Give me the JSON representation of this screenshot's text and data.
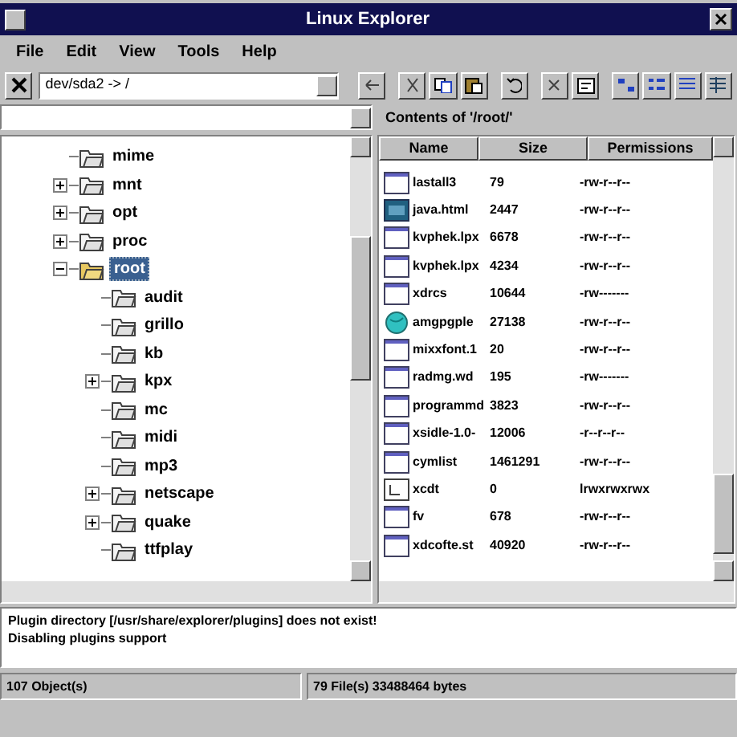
{
  "window": {
    "title": "Linux Explorer"
  },
  "menu": [
    "File",
    "Edit",
    "View",
    "Tools",
    "Help"
  ],
  "address": {
    "value": "dev/sda2 -> /"
  },
  "contents_label": "Contents of '/root/'",
  "tree": [
    {
      "label": "mime",
      "has_children": false,
      "expanded": false,
      "selected": false
    },
    {
      "label": "mnt",
      "has_children": true,
      "expanded": false,
      "selected": false
    },
    {
      "label": "opt",
      "has_children": true,
      "expanded": false,
      "selected": false
    },
    {
      "label": "proc",
      "has_children": true,
      "expanded": false,
      "selected": false
    },
    {
      "label": "root",
      "has_children": true,
      "expanded": true,
      "selected": true,
      "children": [
        {
          "label": "audit",
          "has_children": false,
          "expanded": false,
          "selected": false
        },
        {
          "label": "grillo",
          "has_children": false,
          "expanded": false,
          "selected": false
        },
        {
          "label": "kb",
          "has_children": false,
          "expanded": false,
          "selected": false
        },
        {
          "label": "kpx",
          "has_children": true,
          "expanded": false,
          "selected": false
        },
        {
          "label": "mc",
          "has_children": false,
          "expanded": false,
          "selected": false
        },
        {
          "label": "midi",
          "has_children": false,
          "expanded": false,
          "selected": false
        },
        {
          "label": "mp3",
          "has_children": false,
          "expanded": false,
          "selected": false
        },
        {
          "label": "netscape",
          "has_children": true,
          "expanded": false,
          "selected": false
        },
        {
          "label": "quake",
          "has_children": true,
          "expanded": false,
          "selected": false
        },
        {
          "label": "ttfplay",
          "has_children": false,
          "expanded": false,
          "selected": false
        }
      ]
    }
  ],
  "file_columns": [
    "Name",
    "Size",
    "Permissions"
  ],
  "files": [
    {
      "kind": "file",
      "name": "lastall3",
      "size": "79",
      "permissions": "-rw-r--r--"
    },
    {
      "kind": "html",
      "name": "java.html",
      "size": "2447",
      "permissions": "-rw-r--r--"
    },
    {
      "kind": "file",
      "name": "kvphek.lpx",
      "size": "6678",
      "permissions": "-rw-r--r--"
    },
    {
      "kind": "file",
      "name": "kvphek.lpx",
      "size": "4234",
      "permissions": "-rw-r--r--"
    },
    {
      "kind": "file",
      "name": "xdrcs",
      "size": "10644",
      "permissions": "-rw-------"
    },
    {
      "kind": "globe",
      "name": "amgpgple",
      "size": "27138",
      "permissions": "-rw-r--r--"
    },
    {
      "kind": "file",
      "name": "mixxfont.1",
      "size": "20",
      "permissions": "-rw-r--r--"
    },
    {
      "kind": "file",
      "name": "radmg.wd",
      "size": "195",
      "permissions": "-rw-------"
    },
    {
      "kind": "file",
      "name": "programmd",
      "size": "3823",
      "permissions": "-rw-r--r--"
    },
    {
      "kind": "file",
      "name": "xsidle-1.0-",
      "size": "12006",
      "permissions": "-r--r--r--"
    },
    {
      "kind": "file",
      "name": "cymlist",
      "size": "1461291",
      "permissions": "-rw-r--r--"
    },
    {
      "kind": "link",
      "name": "xcdt",
      "size": "0",
      "permissions": "lrwxrwxrwx"
    },
    {
      "kind": "file",
      "name": "fv",
      "size": "678",
      "permissions": "-rw-r--r--"
    },
    {
      "kind": "file",
      "name": "xdcofte.st",
      "size": "40920",
      "permissions": "-rw-r--r--"
    }
  ],
  "log": [
    "Plugin directory [/usr/share/explorer/plugins] does not exist!",
    "Disabling plugins support"
  ],
  "status_bar": [
    "107 Object(s)",
    "79 File(s) 33488464 bytes"
  ]
}
